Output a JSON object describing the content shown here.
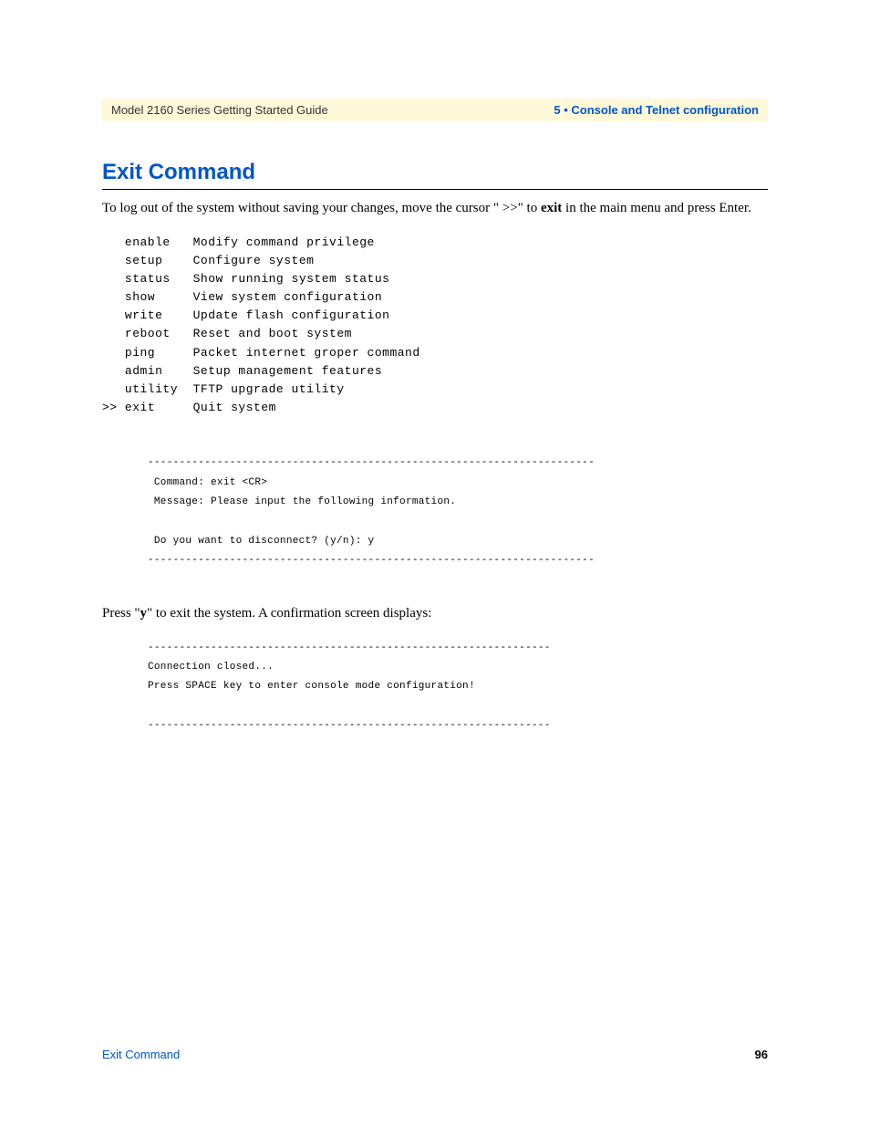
{
  "header": {
    "left": "Model 2160 Series Getting Started Guide",
    "right": "5 • Console and Telnet configuration"
  },
  "section": {
    "title": "Exit Command",
    "intro_pre": "To log out of the system without saving your changes, move the cursor \" >>\" to ",
    "intro_bold": "exit",
    "intro_post": " in the main menu and press Enter."
  },
  "menu": "   enable   Modify command privilege\n   setup    Configure system\n   status   Show running system status\n   show     View system configuration\n   write    Update flash configuration\n   reboot   Reset and boot system\n   ping     Packet internet groper command\n   admin    Setup management features\n   utility  TFTP upgrade utility\n>> exit     Quit system",
  "terminal1": "-----------------------------------------------------------------------\n Command: exit <CR>\n Message: Please input the following information.\n\n Do you want to disconnect? (y/n): y\n-----------------------------------------------------------------------",
  "confirm": {
    "pre": "Press \"",
    "bold": "y",
    "post": "\" to exit the system. A confirmation screen displays:"
  },
  "terminal2": "----------------------------------------------------------------\nConnection closed...\nPress SPACE key to enter console mode configuration!\n\n----------------------------------------------------------------",
  "footer": {
    "left": "Exit Command",
    "right": "96"
  }
}
